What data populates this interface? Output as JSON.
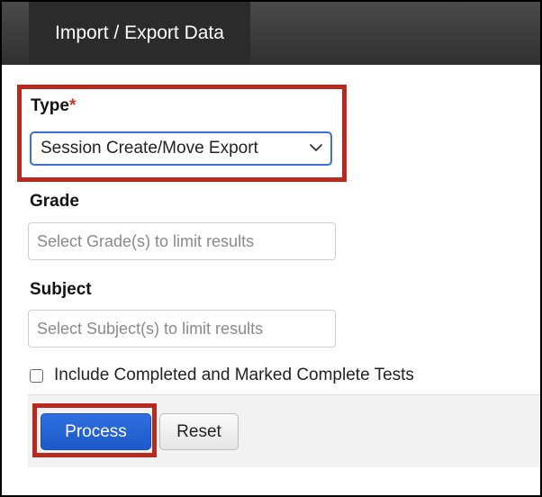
{
  "header": {
    "tab_label": "Import / Export Data"
  },
  "form": {
    "type": {
      "label": "Type",
      "required_marker": "*",
      "selected_value": "Session Create/Move Export"
    },
    "grade": {
      "label": "Grade",
      "placeholder": "Select Grade(s) to limit results"
    },
    "subject": {
      "label": "Subject",
      "placeholder": "Select Subject(s) to limit results"
    },
    "include_completed": {
      "label": "Include Completed and Marked Complete Tests",
      "checked": false
    }
  },
  "actions": {
    "process_label": "Process",
    "reset_label": "Reset"
  },
  "colors": {
    "highlight": "#b82a1e",
    "primary": "#1d59c8",
    "header_bg": "#2b2b2b"
  },
  "icons": {
    "select_chevron": "chevron-down-icon"
  }
}
